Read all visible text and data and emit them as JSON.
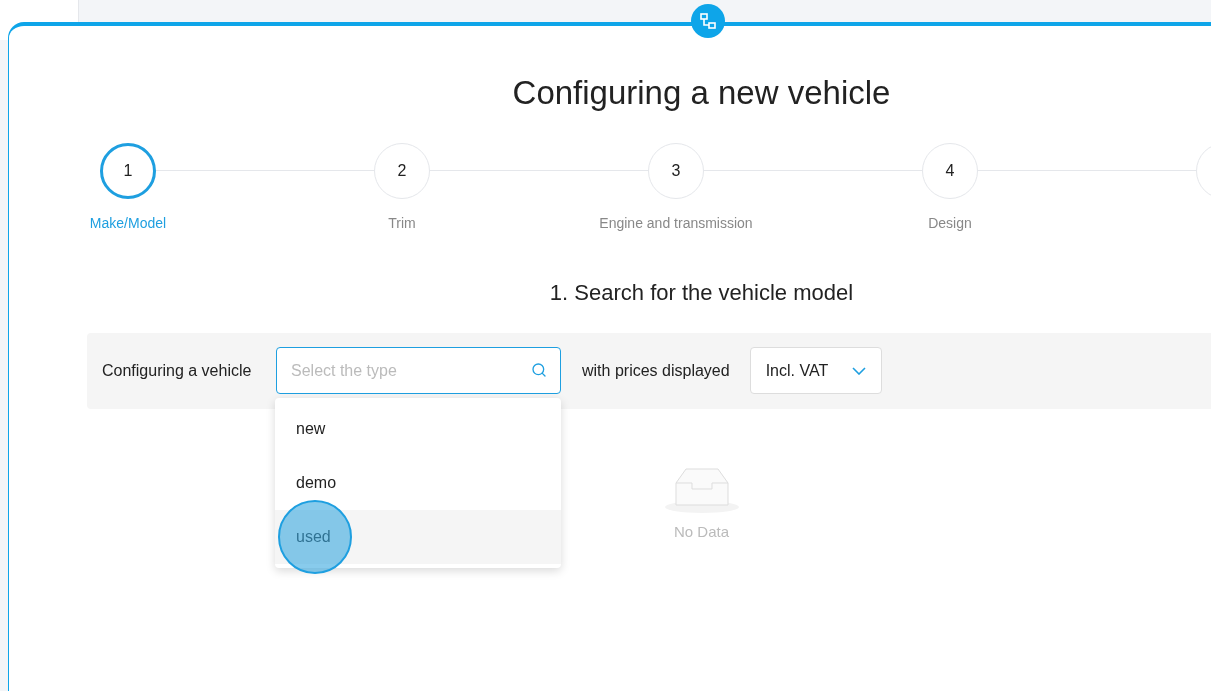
{
  "title": "Configuring a new vehicle",
  "steps": [
    {
      "number": "1",
      "label": "Make/Model",
      "selected": true
    },
    {
      "number": "2",
      "label": "Trim",
      "selected": false
    },
    {
      "number": "3",
      "label": "Engine and transmission",
      "selected": false
    },
    {
      "number": "4",
      "label": "Design",
      "selected": false
    }
  ],
  "section_title": "1. Search for the vehicle model",
  "filter_bar": {
    "label": "Configuring a vehicle",
    "type_field": {
      "placeholder": "Select the type",
      "expanded": true
    },
    "prices_label": "with prices displayed",
    "prices_select": {
      "value": "Incl. VAT"
    }
  },
  "type_options": [
    {
      "label": "new",
      "selected": false
    },
    {
      "label": "demo",
      "selected": false
    },
    {
      "label": "used",
      "selected": true
    }
  ],
  "empty_state": {
    "text": "No Data"
  }
}
